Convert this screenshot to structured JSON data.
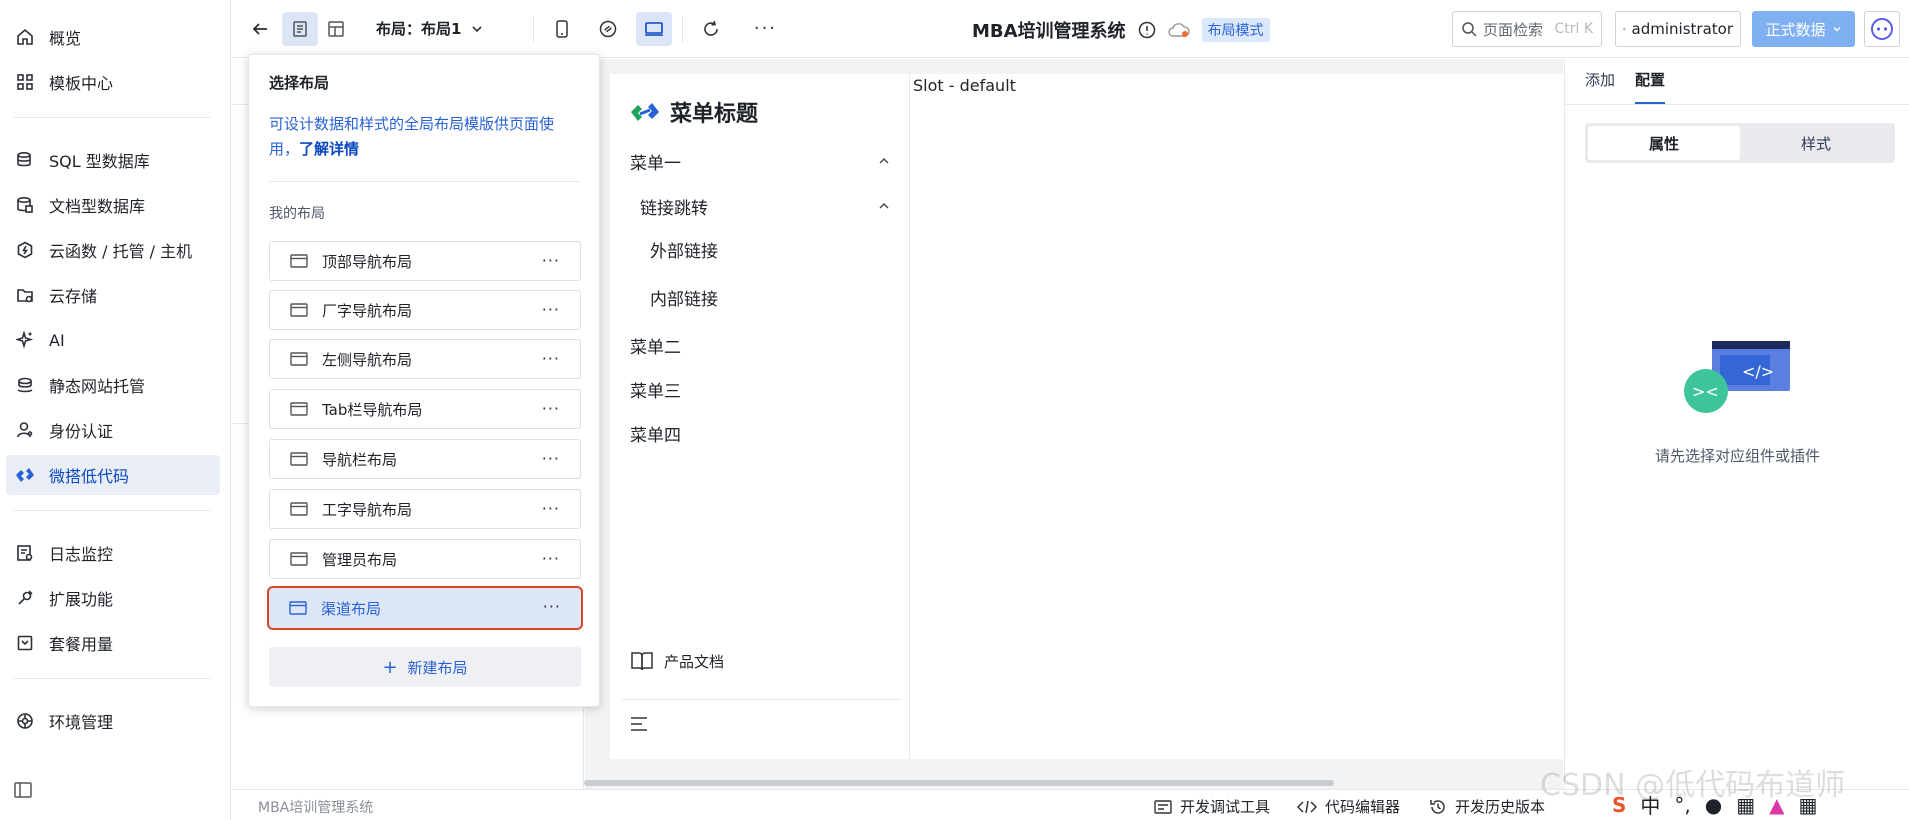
{
  "nav": {
    "items": [
      {
        "label": "概览",
        "icon": "home-icon"
      },
      {
        "label": "模板中心",
        "icon": "grid-icon"
      },
      {
        "label": "SQL 型数据库",
        "icon": "database-icon"
      },
      {
        "label": "文档型数据库",
        "icon": "document-database-icon"
      },
      {
        "label": "云函数 / 托管 / 主机",
        "icon": "function-icon"
      },
      {
        "label": "云存储",
        "icon": "storage-icon"
      },
      {
        "label": "AI",
        "icon": "sparkle-icon"
      },
      {
        "label": "静态网站托管",
        "icon": "hosting-icon"
      },
      {
        "label": "身份认证",
        "icon": "user-auth-icon"
      },
      {
        "label": "微搭低代码",
        "icon": "lowcode-icon"
      },
      {
        "label": "日志监控",
        "icon": "log-icon"
      },
      {
        "label": "扩展功能",
        "icon": "extension-icon"
      },
      {
        "label": "套餐用量",
        "icon": "package-icon"
      },
      {
        "label": "环境管理",
        "icon": "environment-icon"
      }
    ],
    "active_index": 9
  },
  "topbar": {
    "layout_label": "布局：布局1",
    "system_title": "MBA培训管理系统",
    "mode_badge": "布局模式",
    "search_placeholder": "页面检索",
    "search_shortcut": "Ctrl K",
    "user_name": "administrator",
    "data_button": "正式数据"
  },
  "popover": {
    "title": "选择布局",
    "desc": "可设计数据和样式的全局布局模版供页面使用，",
    "desc_link": "了解详情",
    "sub_title": "我的布局",
    "layouts": [
      "顶部导航布局",
      "厂字导航布局",
      "左侧导航布局",
      "Tab栏导航布局",
      "导航栏布局",
      "工字导航布局",
      "管理员布局",
      "渠道布局"
    ],
    "selected_index": 7,
    "new_button": "新建布局"
  },
  "canvas": {
    "brand_title": "菜单标题",
    "menu": [
      {
        "label": "菜单一",
        "chev": "^"
      },
      {
        "label": "链接跳转",
        "chev": "^"
      },
      {
        "label": "外部链接",
        "chev": ""
      },
      {
        "label": "内部链接",
        "chev": ""
      },
      {
        "label": "菜单二",
        "chev": ""
      },
      {
        "label": "菜单三",
        "chev": ""
      },
      {
        "label": "菜单四",
        "chev": ""
      }
    ],
    "doc_link": "产品文档",
    "slot_text": "Slot - default"
  },
  "rightpanel": {
    "tabs": [
      "添加",
      "配置"
    ],
    "active_tab": 1,
    "segments": [
      "属性",
      "样式"
    ],
    "active_segment": 0,
    "empty_text": "请先选择对应组件或插件"
  },
  "bottombar": {
    "app_name": "MBA培训管理系统",
    "items": [
      "开发调试工具",
      "代码编辑器",
      "开发历史版本"
    ]
  },
  "watermark": "CSDN @低代码布道师",
  "colors": {
    "accent": "#2962d6",
    "active_nav_bg": "#e8edf6",
    "selected_border": "#d9472b",
    "primary_button": "#7fb0f2"
  }
}
